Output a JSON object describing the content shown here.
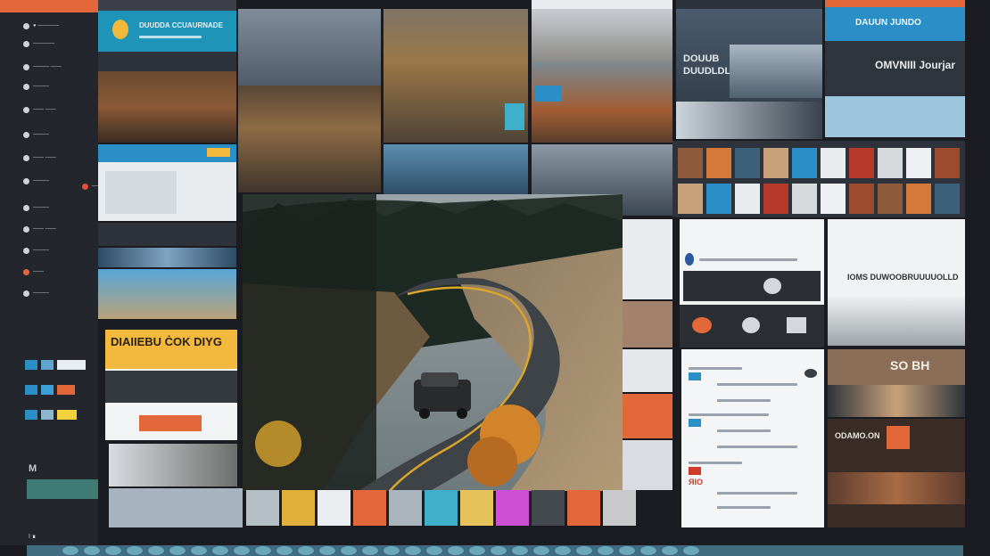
{
  "sidebar": {
    "rows": [
      {
        "label": "● ————",
        "color": "#cfd3d8"
      },
      {
        "label": "————",
        "color": "#cfd3d8"
      },
      {
        "label": "——— ——",
        "color": "#cfd3d8"
      },
      {
        "label": "———",
        "color": "#cfd3d8"
      },
      {
        "label": "—— ——",
        "color": "#cfd3d8"
      },
      {
        "label": "———",
        "color": "#cfd3d8"
      },
      {
        "label": "—— ——",
        "color": "#cfd3d8"
      },
      {
        "label": "———",
        "color": "#cfd3d8"
      },
      {
        "label": "——",
        "color": "#e24f3a"
      },
      {
        "label": "———",
        "color": "#cfd3d8"
      },
      {
        "label": "—— ——",
        "color": "#cfd3d8"
      },
      {
        "label": "———",
        "color": "#cfd3d8"
      },
      {
        "label": "——",
        "color": "#e2683a"
      },
      {
        "label": "———",
        "color": "#cfd3d8"
      }
    ],
    "footer_a": "M",
    "footer_b": "I ∎"
  },
  "tiles": {
    "top_left_title": "DUUDDA CCUAURNADE",
    "top_right_title": "DAUUN JUNDO",
    "mid_right_title_a": "DOUUB",
    "mid_right_title_b": "DUUDLDL",
    "journal_title": "OMVNIII Jourjar",
    "wide_text": "IOMS DUWOOBRUUUUOLLD",
    "orange_card_title": "DIAIIEBU   ĊOK DIYG",
    "brown_card_title": "SO BH",
    "sub_heading": "ODAMO.ON",
    "red_code": "ЯIO"
  },
  "colors": {
    "accent_orange": "#e2683a",
    "accent_blue": "#2a8fc7",
    "yellow": "#f2b93c",
    "road_yellow": "#d9a52a"
  },
  "icons": [
    "sidebar-dot-icon",
    "camera-icon",
    "soccer-icon",
    "grid-icon",
    "map-pin-icon"
  ]
}
